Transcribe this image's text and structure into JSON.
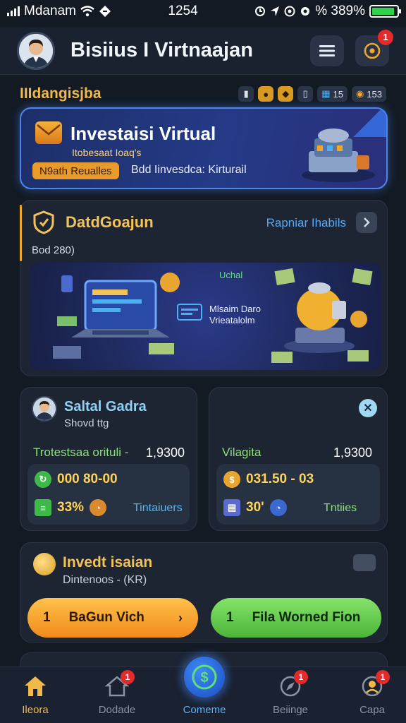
{
  "status_bar": {
    "carrier": "Mdanam",
    "time": "1254",
    "battery_percent": "% 389%",
    "battery_level": 0.9
  },
  "header": {
    "title": "Bisiius I Virtnaajan",
    "settings_badge": "1"
  },
  "section": {
    "label": "IIIdangisjba",
    "chip_a": "15",
    "chip_b": "153"
  },
  "hero": {
    "title": "Investaisi Virtual",
    "subtitle": "Itobesaat Ioaq's",
    "pill": "N9ath Reualles",
    "desc": "Bdd Iinvesdca: Kirturail"
  },
  "feature_card": {
    "title": "DatdGoajun",
    "link": "Rapniar Ihabils",
    "meta": "Bod 280)",
    "illus_text1": "Uchal",
    "illus_text2_line1": "Mlsaim Daro",
    "illus_text2_line2": "Vrieatalolm"
  },
  "profile_card": {
    "name": "Saltal Gadra",
    "sub": "Shovd ttg",
    "row_label": "Trotestsaa orituli -",
    "row_value": "1,9300",
    "stat1": "000 80-00",
    "stat2": "33%",
    "link": "Tintaiuers"
  },
  "right_card": {
    "row_label": "Vilagita",
    "row_value": "1,9300",
    "stat1": "031.50 - 03",
    "stat2": "30'",
    "link": "Tntiies"
  },
  "invest_card": {
    "title": "Invedt isaian",
    "sub": "Dintenoos - (KR)",
    "btn_primary_num": "1",
    "btn_primary_label": "BaGun Vich",
    "btn_secondary_num": "1",
    "btn_secondary_label": "Fila Worned Fion"
  },
  "bottom_nav": {
    "items": [
      {
        "label": "Ileora"
      },
      {
        "label": "Dodade",
        "badge": "1"
      },
      {
        "label": "Comeme"
      },
      {
        "label": "Beiinge",
        "badge": "1"
      },
      {
        "label": "Capa",
        "badge": "1"
      }
    ]
  },
  "colors": {
    "background": "#131a24",
    "accent_gold": "#f0b94a",
    "accent_blue": "#4a86f0",
    "accent_green": "#8fe07c",
    "badge_red": "#e32b2b"
  }
}
